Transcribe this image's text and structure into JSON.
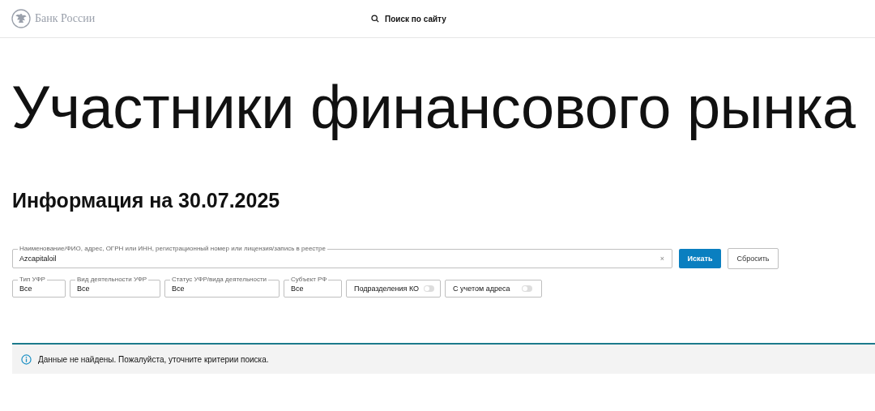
{
  "header": {
    "logo_text": "Банк России",
    "search_label": "Поиск по сайту"
  },
  "title": "Участники финансового рынка",
  "subtitle": "Информация на 30.07.2025",
  "search": {
    "label": "Наименование/ФИО, адрес, ОГРН или ИНН, регистрационный номер или лицензия/запись в реестре",
    "value": "Azcapitaloil",
    "clear": "×",
    "submit": "Искать",
    "reset": "Сбросить"
  },
  "filters": [
    {
      "kind": "select",
      "label": "Тип УФР",
      "value": "Все"
    },
    {
      "kind": "select",
      "label": "Вид деятельности УФР",
      "value": "Все"
    },
    {
      "kind": "select",
      "label": "Статус УФР/вида деятельности",
      "value": "Все"
    },
    {
      "kind": "select",
      "label": "Субъект РФ",
      "value": "Все"
    },
    {
      "kind": "toggle",
      "label": "Подразделения КО",
      "on": false
    },
    {
      "kind": "toggle",
      "label": "С учетом адреса",
      "on": false
    }
  ],
  "notice": "Данные не найдены. Пожалуйста, уточните критерии поиска."
}
